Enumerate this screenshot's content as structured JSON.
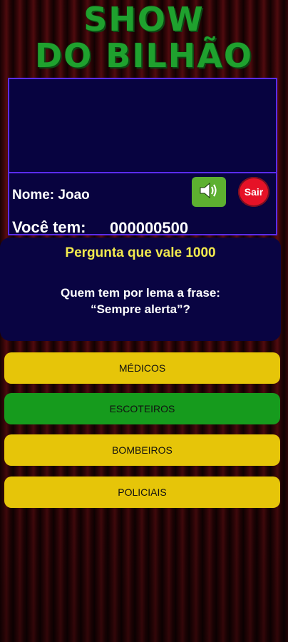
{
  "title": {
    "line1": "SHOW",
    "line2": "DO BILHÃO"
  },
  "player": {
    "name_text": "Nome: Joao",
    "money_label": "Você tem:",
    "money_value": "000000500"
  },
  "controls": {
    "sound_icon": "speaker-volume-icon",
    "exit_label": "Sair"
  },
  "question": {
    "value_text": "Pergunta que vale 1000",
    "line1": "Quem tem por lema a frase:",
    "line2": "“Sempre alerta”?"
  },
  "answers": [
    {
      "label": "MÉDICOS"
    },
    {
      "label": "ESCOTEIROS"
    },
    {
      "label": "BOMBEIROS"
    },
    {
      "label": "POLICIAIS"
    }
  ],
  "colors": {
    "title_green": "#1fa12e",
    "panel_navy": "#090442",
    "panel_border": "#5b2cff",
    "answer_yellow": "#e6c509",
    "answer_correct_green": "#169b1d",
    "question_value_yellow": "#f3ea4d",
    "exit_red": "#e61227",
    "sound_green": "#5db030"
  }
}
